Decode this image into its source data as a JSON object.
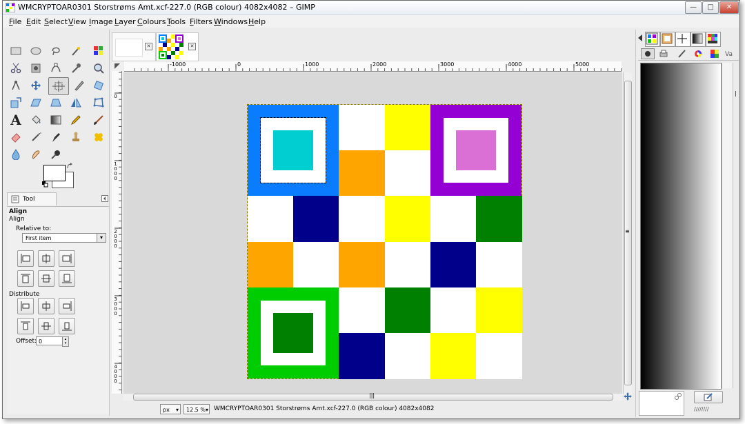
{
  "window": {
    "title": "WMCRYPTOAR0301 Storstrøms Amt.xcf-227.0 (RGB colour) 4082x4082 – GIMP",
    "minimize": "—",
    "maximize": "□",
    "close": "✕"
  },
  "menu": [
    "File",
    "Edit",
    "Select",
    "View",
    "Image",
    "Layer",
    "Colours",
    "Tools",
    "Filters",
    "Windows",
    "Help"
  ],
  "tool_options": {
    "tab_label": "Tool Options",
    "title": "Align",
    "subtitle": "Align",
    "relative_to_label": "Relative to:",
    "relative_to_value": "First item",
    "distribute_label": "Distribute",
    "offset_label": "Offset:",
    "offset_value": "0"
  },
  "ruler": {
    "h": [
      "-1000",
      "0",
      "1000",
      "2000",
      "3000",
      "4000",
      "5000"
    ],
    "v": [
      "0",
      "1000",
      "2000",
      "3000",
      "4000"
    ]
  },
  "status": {
    "unit": "px",
    "zoom": "12.5 %",
    "text": "WMCRYPTOAR0301 Storstrøms Amt.xcf-227.0 (RGB colour) 4082x4082"
  },
  "colors": {
    "blue": "#0a7cff",
    "cyan": "#00ced1",
    "purple": "#9400d3",
    "orchid": "#da70d6",
    "green": "#00cd00",
    "darkgreen": "#008000",
    "navy": "#00008b",
    "yellow": "#ffff00",
    "orange": "#ffa500"
  },
  "pattern_grid": [
    [
      "F1",
      "F1",
      "white",
      "yellow",
      "F2",
      "F2"
    ],
    [
      "F1",
      "F1",
      "orange",
      "white",
      "F2",
      "F2"
    ],
    [
      "white",
      "navy",
      "white",
      "yellow",
      "white",
      "darkgreen"
    ],
    [
      "orange",
      "white",
      "orange",
      "white",
      "navy",
      "white"
    ],
    [
      "F3",
      "F3",
      "white",
      "darkgreen",
      "white",
      "yellow"
    ],
    [
      "F3",
      "F3",
      "navy",
      "white",
      "yellow",
      "white"
    ]
  ],
  "finders": {
    "F1": {
      "outer": "blue",
      "inner": "cyan"
    },
    "F2": {
      "outer": "purple",
      "inner": "orchid"
    },
    "F3": {
      "outer": "green",
      "inner": "darkgreen"
    }
  }
}
